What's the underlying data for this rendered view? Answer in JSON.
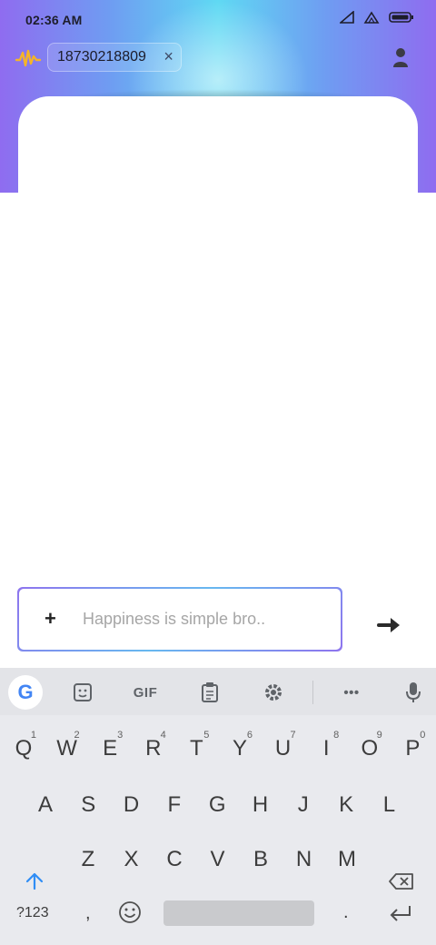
{
  "status": {
    "time": "02:36 AM"
  },
  "topbar": {
    "phone_chip": "18730218809",
    "close_glyph": "×"
  },
  "composer": {
    "plus_glyph": "+",
    "placeholder": "Happiness is simple bro.."
  },
  "keyboard": {
    "toolbar": {
      "google": "G",
      "gif": "GIF",
      "more": "•••"
    },
    "row1": [
      {
        "k": "Q",
        "n": "1"
      },
      {
        "k": "W",
        "n": "2"
      },
      {
        "k": "E",
        "n": "3"
      },
      {
        "k": "R",
        "n": "4"
      },
      {
        "k": "T",
        "n": "5"
      },
      {
        "k": "Y",
        "n": "6"
      },
      {
        "k": "U",
        "n": "7"
      },
      {
        "k": "I",
        "n": "8"
      },
      {
        "k": "O",
        "n": "9"
      },
      {
        "k": "P",
        "n": "0"
      }
    ],
    "row2": [
      "A",
      "S",
      "D",
      "F",
      "G",
      "H",
      "J",
      "K",
      "L"
    ],
    "row3": [
      "Z",
      "X",
      "C",
      "V",
      "B",
      "N",
      "M"
    ],
    "bottom": {
      "symbols": "?123",
      "comma": ",",
      "period": "."
    }
  },
  "colors": {
    "gradient_left": "#8f6cf0",
    "gradient_center": "#5fd9f3",
    "accent_blue": "#2f8df5"
  }
}
